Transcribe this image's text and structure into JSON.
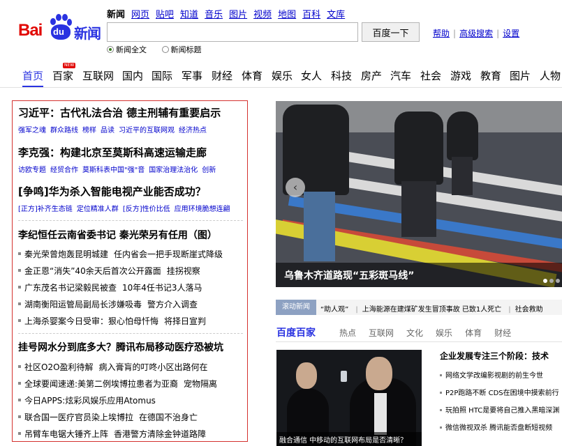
{
  "logo": {
    "bai": "Bai",
    "du": "du",
    "news": "新闻"
  },
  "topnav": [
    "新闻",
    "网页",
    "贴吧",
    "知道",
    "音乐",
    "图片",
    "视频",
    "地图",
    "百科",
    "文库"
  ],
  "search": {
    "value": "",
    "button": "百度一下"
  },
  "toplinks": [
    "帮助",
    "高级搜索",
    "设置"
  ],
  "radios": [
    {
      "label": "新闻全文",
      "checked": true
    },
    {
      "label": "新闻标题",
      "checked": false
    }
  ],
  "menu": {
    "items": [
      "首页",
      "百家",
      "互联网",
      "国内",
      "国际",
      "军事",
      "财经",
      "体育",
      "娱乐",
      "女人",
      "科技",
      "房产",
      "汽车",
      "社会",
      "游戏",
      "教育",
      "图片",
      "人物"
    ],
    "active": "首页",
    "new_badge": "NEW"
  },
  "headlines": [
    {
      "title": "习近平：古代礼法合治 德主刑辅有重要启示",
      "subs": [
        "强军之魂",
        "群众路线",
        "榜样",
        "品读",
        "习近平的互联网观",
        "经济热点"
      ]
    },
    {
      "title": "李克强：构建北京至莫斯科高速运输走廊",
      "subs": [
        "访欧专题",
        "经贸合作",
        "莫斯科表中国\"强\"音",
        "国家治理法治化",
        "创新"
      ]
    },
    {
      "title": "[争鸣]华为杀入智能电视产业能否成功？",
      "subs": [
        "[正方]补齐生态链",
        "定位精准人群",
        "[反方]性价比低",
        "应用环境脆想连翩"
      ]
    }
  ],
  "section1": {
    "title": "李纪恒任云南省委书记 秦光荣另有任用（图）",
    "items": [
      [
        "秦光荣曾炮轰昆明城建",
        "任内省会一把手现断崖式降级"
      ],
      [
        "金正恩“消失”40余天后首次公开露面",
        "挂拐视察"
      ],
      [
        "广东茂名书记梁毅民被查",
        "10年4任书记3人落马"
      ],
      [
        "湖南衡阳运管局副局长涉嫌吸毒",
        "警方介入调查"
      ],
      [
        "上海杀婴案今日受审：狠心怕母忏悔",
        "将择日宣判"
      ]
    ]
  },
  "section2": {
    "title": "挂号网水分到底多大？腾讯布局移动医疗恐被坑",
    "items": [
      [
        "社区O2O盈利待解",
        "病入膏肓的叮咚小区出路何在"
      ],
      [
        "全球要闻速递:美第二例埃博拉患者为亚裔",
        "宠物隔离"
      ],
      [
        "今日APPS:炫彩风娱乐应用Atomus",
        ""
      ],
      [
        "联合国一医疗官员染上埃博拉",
        "在德国不治身亡"
      ],
      [
        "吊臂车电锯大锤齐上阵",
        "香港警方清除金钟道路障"
      ]
    ]
  },
  "photo": {
    "caption": "乌鲁木齐道路现“五彩斑马线”",
    "prev": "‹"
  },
  "ticker": {
    "tag": "滚动新闻",
    "items": [
      "“助人观”",
      "上海能源在建煤矿发生冒顶事故 已致1人死亡",
      "社会救助"
    ]
  },
  "baijia": {
    "title": "百度百家",
    "tabs": [
      "热点",
      "互联网",
      "文化",
      "娱乐",
      "体育",
      "财经"
    ],
    "image_caption": "融合通信 中移动的互联网布局是否清晰？",
    "right_title": "企业发展专注三个阶段：技术",
    "right_items": [
      "网络文学改编影视剧的前生今世",
      "P2P跑路不断 CDS在困境中摸索前行",
      "玩拍照 HTC是要将自己推入黑暗深渊",
      "微信微视双杀 腾讯能否盘断短视频"
    ]
  }
}
